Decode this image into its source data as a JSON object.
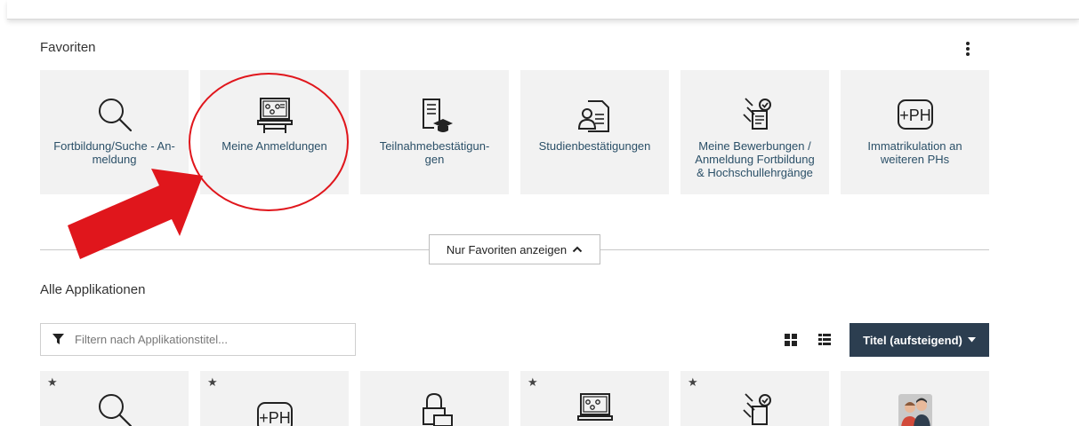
{
  "favorites": {
    "title": "Favoriten",
    "tiles": [
      {
        "label": "Fortbildung/Suche - An-\nmeldung",
        "icon": "magnifier-icon"
      },
      {
        "label": "Meine Anmeldungen",
        "icon": "presentation-board-icon"
      },
      {
        "label": "Teilnahmebestätigun-\ngen",
        "icon": "document-graduation-icon"
      },
      {
        "label": "Studienbestätigungen",
        "icon": "certificate-user-icon"
      },
      {
        "label": "Meine Bewerbungen /\nAnmeldung Fortbildung\n& Hochschullehrgänge",
        "icon": "hand-document-check-icon"
      },
      {
        "label": "Immatrikulation an\nweiteren PHs",
        "icon": "plus-ph-icon"
      }
    ]
  },
  "toggle": {
    "label": "Nur Favoriten anzeigen"
  },
  "all_apps": {
    "title": "Alle Applikationen",
    "filter_placeholder": "Filtern nach Applikationstitel...",
    "sort_label": "Titel (aufsteigend)",
    "tiles": [
      {
        "icon": "magnifier-icon",
        "starred": true
      },
      {
        "icon": "plus-ph-icon",
        "starred": true
      },
      {
        "icon": "lock-password-icon",
        "starred": false
      },
      {
        "icon": "presentation-board-icon",
        "starred": true
      },
      {
        "icon": "hand-document-check-icon",
        "starred": true
      },
      {
        "icon": "people-avatar-icon",
        "starred": false
      }
    ]
  },
  "colors": {
    "accent": "#2c3e50",
    "tile_bg": "#f2f2f2",
    "label": "#2b5068",
    "annotation": "#e0161c"
  }
}
